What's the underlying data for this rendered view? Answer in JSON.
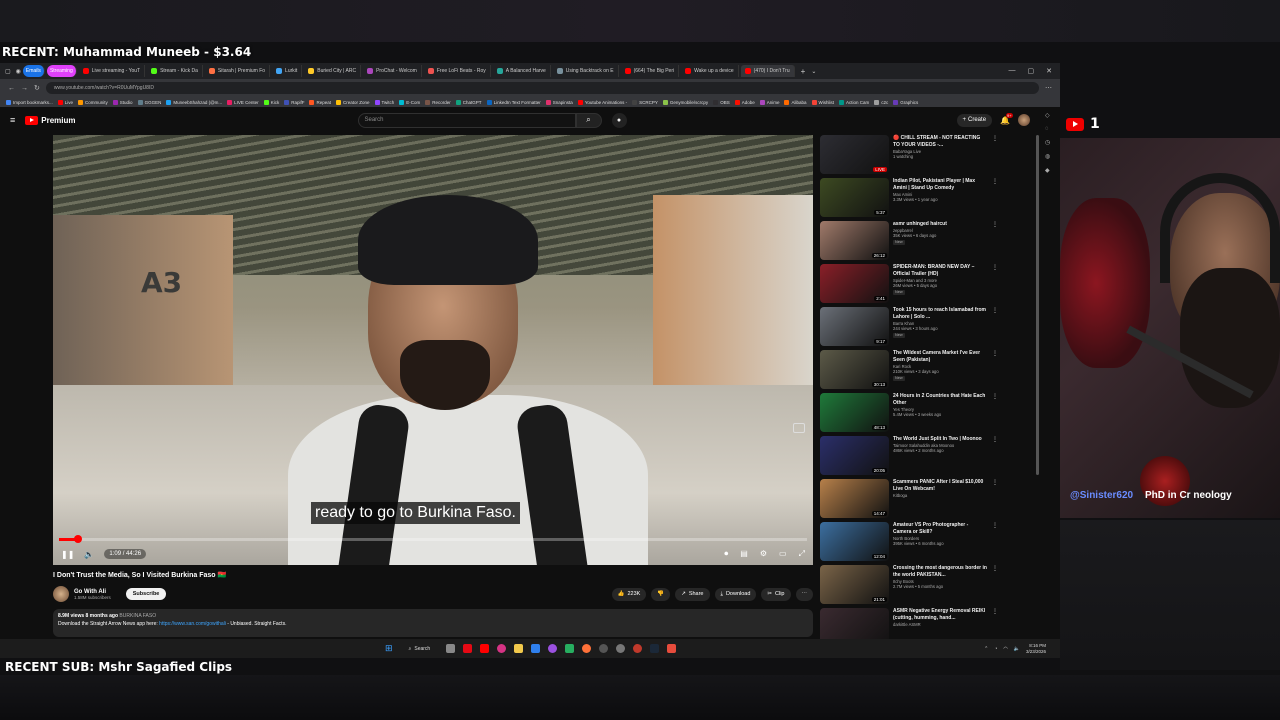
{
  "overlay": {
    "recent_donation": "RECENT: Muhammad Muneeb - $3.64",
    "recent_sub": "RECENT SUB: Mshr Sagafied Clips",
    "yt_viewer_count": "1",
    "cam_handle": "@Sinister620",
    "cam_text": "PhD in Cr neology"
  },
  "browser": {
    "tabs": [
      {
        "label": "Emails",
        "color": "#1a73e8",
        "pill": true
      },
      {
        "label": "Streaming",
        "color": "#e040fb",
        "pill": true
      },
      {
        "label": "Live streaming - YouT",
        "color": "#ff0000"
      },
      {
        "label": "Stream - Kick Da",
        "color": "#53fc18"
      },
      {
        "label": "Sitarah | Premium Fo",
        "color": "#ff7043"
      },
      {
        "label": "Lurkit",
        "color": "#42a5f5"
      },
      {
        "label": "Buried City | ARC",
        "color": "#ffca28"
      },
      {
        "label": "ProChat - Welcom",
        "color": "#ab47bc"
      },
      {
        "label": "Free LoFi Beats - Roy",
        "color": "#ef5350"
      },
      {
        "label": "A Balanced Harve",
        "color": "#26a69a"
      },
      {
        "label": "Using Backtrack on E",
        "color": "#78909c"
      },
      {
        "label": "(664) The Big Peri",
        "color": "#ff0000"
      },
      {
        "label": "Wake up a device",
        "color": "#ff0000"
      },
      {
        "label": "(470) I Don't Tru",
        "color": "#ff0000",
        "active": true
      }
    ],
    "url": "www.youtube.com/watch?v=R0UuMYpgU8ID",
    "bookmarks": [
      "Import bookmarks...",
      "Live",
      "Community",
      "Studio",
      "GGGEN",
      "MuneebShahzad (@m...",
      "LIVE Center",
      "Kick",
      "RapifF",
      "Repeat",
      "Creator Zone",
      "Twitch",
      "E-Com",
      "Recorder",
      "ChatGPT",
      "LinkedIn Text Formatter",
      "Snapinsta",
      "Youtube Animations -",
      "SCRCPY",
      "Genymobile/scrcpy",
      "OBS",
      "Adobe",
      "Anime",
      "Alibaba",
      "Wishlist",
      "Action Cam",
      "c2c",
      "Graphics"
    ]
  },
  "youtube": {
    "logo": "Premium",
    "search_placeholder": "Search",
    "create_label": "Create",
    "notif_count": "9+",
    "subtitle": "ready to go to Burkina Faso.",
    "time": "1:09 / 44:26",
    "progress_fraction": 0.026,
    "title": "I Don't Trust the Media, So I Visited Burkina Faso 🇧🇫",
    "channel": "Go With Ali",
    "subscribers": "1.58M subscribers",
    "subscribe_label": "Subscribe",
    "likes": "223K",
    "share_label": "Share",
    "download_label": "Download",
    "clip_label": "Clip",
    "desc_meta": "8.9M views  8 months ago",
    "desc_tag": "BURKINA FASO",
    "desc_text": "Download the Straight Arrow News app here:",
    "desc_link": "https://www.san.com/gowithali",
    "desc_tail": " - Unbiased. Straight Facts.",
    "gate_sign": "A3"
  },
  "recommendations": [
    {
      "title": "🔴 CHILL STREAM - NOT REACTING TO YOUR VIDEOS -...",
      "channel": "BabaYaga Live",
      "meta": "1 watching",
      "badge": "LIVE",
      "thumb": "#2d2d33"
    },
    {
      "title": "Indian Pilot, Pakistani Player | Max Amini | Stand Up Comedy",
      "channel": "Max Amini",
      "meta": "3.3M views • 1 year ago",
      "dur": "5:37",
      "thumb": "#3d4a22"
    },
    {
      "title": "asmr unhinged haircut",
      "channel": "zeppbarrel",
      "meta": "35K views • 6 days ago",
      "new": "New",
      "dur": "26:12",
      "thumb": "#a07a6a"
    },
    {
      "title": "SPIDER-MAN: BRAND NEW DAY – Official Trailer (HD)",
      "channel": "Spider-Man and 3 more",
      "meta": "26M views • 5 days ago",
      "new": "New",
      "dur": "2:41",
      "thumb": "#8a1f28"
    },
    {
      "title": "Took 15 hours to reach Islamabad from Lahore | Solo ...",
      "channel": "Barra Khan",
      "meta": "244 views • 3 hours ago",
      "new": "New",
      "dur": "9:17",
      "thumb": "#6b7078"
    },
    {
      "title": "The Wildest Camera Market I've Ever Seen (Pakistan)",
      "channel": "Kari Rock",
      "meta": "210K views • 3 days ago",
      "new": "New",
      "dur": "30:13",
      "thumb": "#5c5a48"
    },
    {
      "title": "24 Hours in 2 Countries that Hate Each Other",
      "channel": "Yes Theory",
      "meta": "5.4M views • 3 weeks ago",
      "dur": "48:13",
      "thumb": "#1f7a3a"
    },
    {
      "title": "The World Just Split In Two | Moonoo",
      "channel": "Taimoor Salahuddin aka Moonoo",
      "meta": "486K views • 2 months ago",
      "dur": "20:05",
      "thumb": "#2b2f6a"
    },
    {
      "title": "Scammers PANIC After I Steal $10,000 Live On Webcam!",
      "channel": "Kitboga",
      "meta": "",
      "dur": "14:47",
      "thumb": "#b7804a"
    },
    {
      "title": "Amateur VS Pro Photographer - Camera or Skill?",
      "channel": "North Borders",
      "meta": "395K views • 6 months ago",
      "dur": "12:04",
      "thumb": "#3c6fa0"
    },
    {
      "title": "Crossing the most dangerous border in the world PAKISTAN...",
      "channel": "Itchy Boots",
      "meta": "2.7M views • 5 months ago",
      "dur": "21:01",
      "thumb": "#7a6448"
    },
    {
      "title": "ASMR Negative Energy Removal REIKI (cutting, humming, hand...",
      "channel": "darkittle ASMR",
      "meta": "",
      "thumb": "#3a2a30"
    }
  ],
  "taskbar": {
    "search_label": "Search",
    "time": "8:16 PM",
    "date": "3/23/2026"
  }
}
